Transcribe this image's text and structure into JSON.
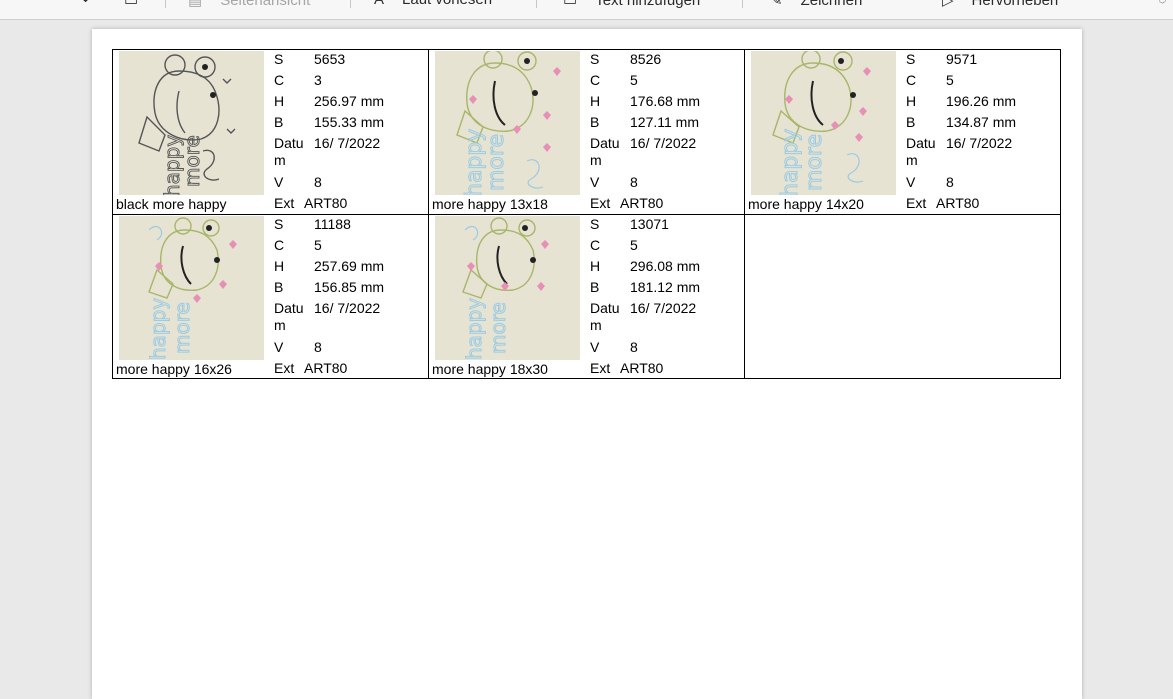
{
  "toolbar": {
    "items": [
      {
        "label": "Seitenansicht",
        "icon": "page-view-icon",
        "disabled": true
      },
      {
        "label": "Laut vorlesen",
        "icon": "read-aloud-icon"
      },
      {
        "label": "Text hinzufügen",
        "icon": "add-text-icon"
      },
      {
        "label": "Zeichnen",
        "icon": "draw-icon"
      },
      {
        "label": "Hervorheben",
        "icon": "highlight-icon"
      }
    ]
  },
  "labels": {
    "s": "S",
    "c": "C",
    "h": "H",
    "b": "B",
    "datum": "Datu m",
    "v": "V",
    "ext": "Ext"
  },
  "designs": [
    {
      "name": "black more happy",
      "s": "5653",
      "c": "3",
      "h": "256.97 mm",
      "b": "155.33 mm",
      "datum": "16/ 7/2022",
      "v": "8",
      "ext": "ART80",
      "thumb": "black-outline"
    },
    {
      "name": "more happy 13x18",
      "s": "8526",
      "c": "5",
      "h": "176.68 mm",
      "b": "127.11 mm",
      "datum": "16/ 7/2022",
      "v": "8",
      "ext": "ART80",
      "thumb": "color"
    },
    {
      "name": "more happy 14x20",
      "s": "9571",
      "c": "5",
      "h": "196.26 mm",
      "b": "134.87 mm",
      "datum": "16/ 7/2022",
      "v": "8",
      "ext": "ART80",
      "thumb": "color"
    },
    {
      "name": "more happy 16x26",
      "s": "11188",
      "c": "5",
      "h": "257.69 mm",
      "b": "156.85 mm",
      "datum": "16/ 7/2022",
      "v": "8",
      "ext": "ART80",
      "thumb": "color"
    },
    {
      "name": "more happy 18x30",
      "s": "13071",
      "c": "5",
      "h": "296.08 mm",
      "b": "181.12 mm",
      "datum": "16/ 7/2022",
      "v": "8",
      "ext": "ART80",
      "thumb": "color"
    }
  ],
  "colors": {
    "thumb_bg": "#e6e3d3",
    "frog_outline": "#a8b66a",
    "heart": "#e88fb8",
    "text_blue": "#9bcbe3",
    "black_outline": "#555555"
  }
}
